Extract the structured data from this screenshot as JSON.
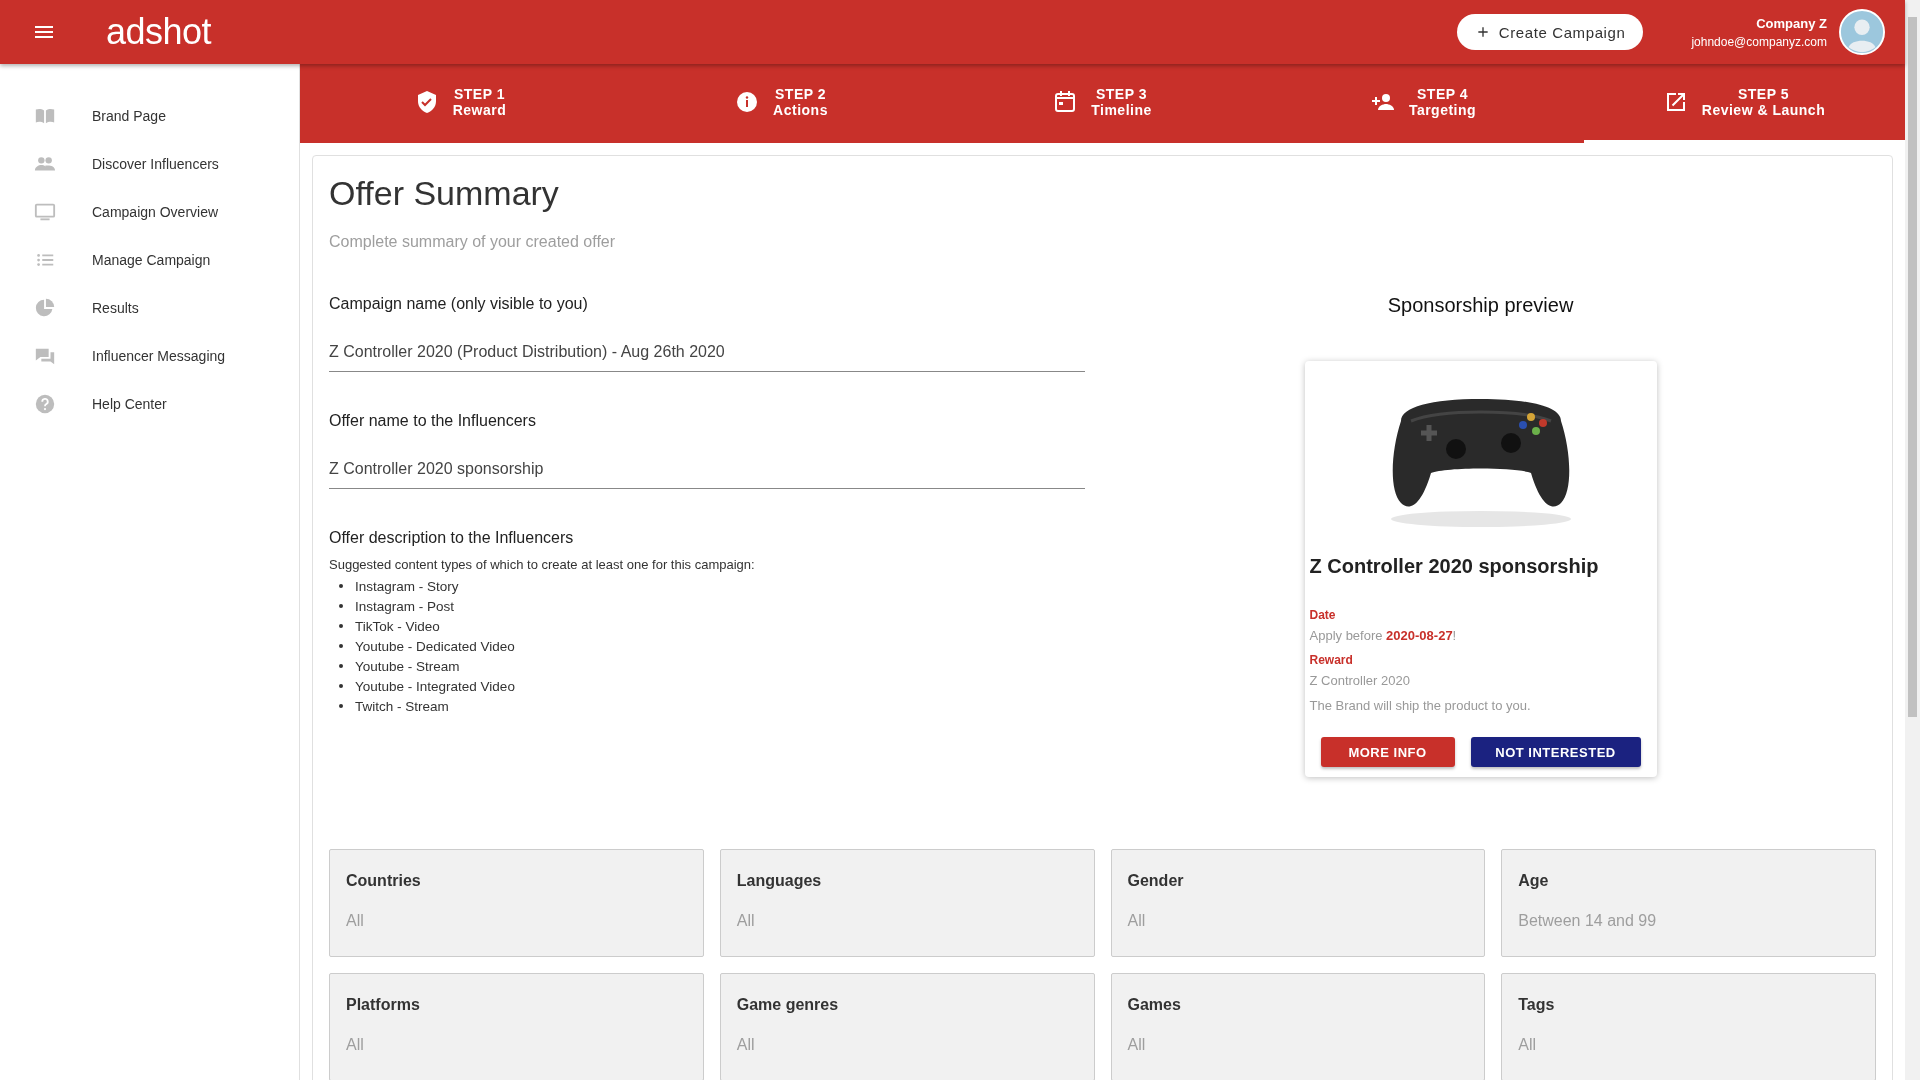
{
  "header": {
    "logo": "adshot",
    "create_button": "Create Campaign",
    "user": {
      "company": "Company Z",
      "email": "johndoe@companyz.com"
    }
  },
  "sidebar": {
    "items": [
      {
        "label": "Brand Page"
      },
      {
        "label": "Discover Influencers"
      },
      {
        "label": "Campaign Overview"
      },
      {
        "label": "Manage Campaign"
      },
      {
        "label": "Results"
      },
      {
        "label": "Influencer Messaging"
      },
      {
        "label": "Help Center"
      }
    ]
  },
  "steps": [
    {
      "step": "STEP 1",
      "label": "Reward",
      "selected": false
    },
    {
      "step": "STEP 2",
      "label": "Actions",
      "selected": false
    },
    {
      "step": "STEP 3",
      "label": "Timeline",
      "selected": false
    },
    {
      "step": "STEP 4",
      "label": "Targeting",
      "selected": false
    },
    {
      "step": "STEP 5",
      "label": "Review & Launch",
      "selected": true
    }
  ],
  "summary": {
    "title": "Offer Summary",
    "subtitle": "Complete summary of your created offer",
    "fields": [
      {
        "label": "Campaign name (only visible to you)",
        "value": "Z Controller 2020 (Product Distribution) - Aug 26th 2020"
      },
      {
        "label": "Offer name to the Influencers",
        "value": "Z Controller 2020 sponsorship"
      }
    ],
    "description": {
      "label": "Offer description to the Influencers",
      "intro": "Suggested content types of which to create at least one for this campaign:",
      "items": [
        "Instagram - Story",
        "Instagram - Post",
        "TikTok - Video",
        "Youtube - Dedicated Video",
        "Youtube - Stream",
        "Youtube - Integrated Video",
        "Twitch - Stream"
      ]
    }
  },
  "preview": {
    "heading": "Sponsorship preview",
    "title": "Z Controller 2020 sponsorship",
    "date_label": "Date",
    "date_text": "Apply before **2020-08-27**!",
    "reward_label": "Reward",
    "reward_lines": [
      "Z Controller 2020",
      "The Brand will ship the product to you."
    ],
    "more_button": "MORE INFO",
    "not_button": "NOT INTERESTED"
  },
  "filters": [
    {
      "label": "Countries",
      "value": "All"
    },
    {
      "label": "Languages",
      "value": "All"
    },
    {
      "label": "Gender",
      "value": "All"
    },
    {
      "label": "Age",
      "value": "Between 14 and 99"
    },
    {
      "label": "Platforms",
      "value": "All"
    },
    {
      "label": "Game genres",
      "value": "All"
    },
    {
      "label": "Games",
      "value": "All"
    },
    {
      "label": "Tags",
      "value": "All"
    }
  ]
}
